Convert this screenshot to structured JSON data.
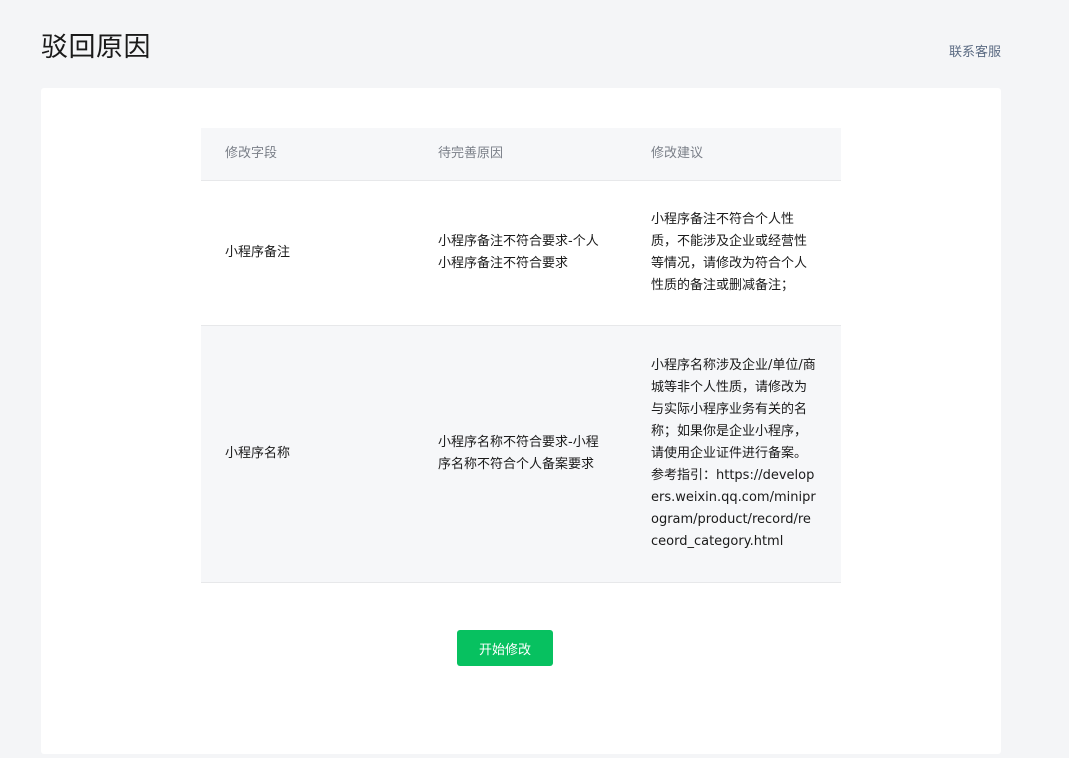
{
  "header": {
    "title": "驳回原因",
    "contact_label": "联系客服"
  },
  "table": {
    "columns": [
      "修改字段",
      "待完善原因",
      "修改建议"
    ],
    "rows": [
      {
        "field": "小程序备注",
        "reason": "小程序备注不符合要求-个人小程序备注不符合要求",
        "suggestion": "小程序备注不符合个人性质，不能涉及企业或经营性等情况，请修改为符合个人性质的备注或删减备注；"
      },
      {
        "field": "小程序名称",
        "reason": "小程序名称不符合要求-小程序名称不符合个人备案要求",
        "suggestion": "小程序名称涉及企业/单位/商城等非个人性质，请修改为与实际小程序业务有关的名称；如果你是企业小程序，请使用企业证件进行备案。参考指引：https://developers.weixin.qq.com/miniprogram/product/record/receord_category.html"
      }
    ]
  },
  "actions": {
    "start_edit_label": "开始修改",
    "accent_color": "#07c160"
  }
}
